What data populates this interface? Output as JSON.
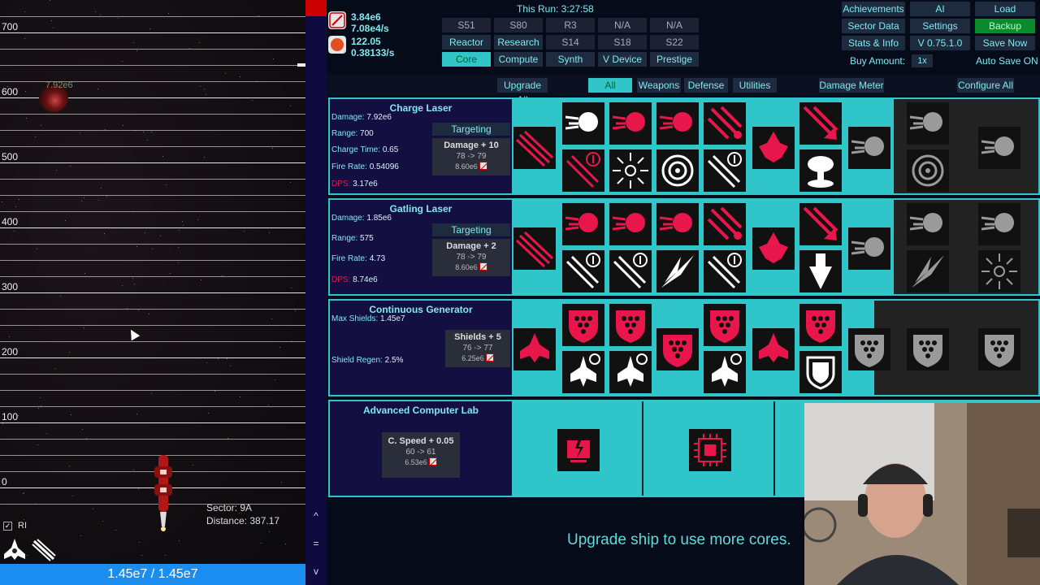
{
  "game": {
    "y_axis_labels": [
      "700",
      "600",
      "500",
      "400",
      "300",
      "200",
      "100",
      "0"
    ],
    "enemy_hp": "7.92e6",
    "sector": "Sector: 9A",
    "distance": "Distance: 387.17",
    "ri_label": "RI",
    "ri_check": "✓",
    "hp": "1.45e7 / 1.45e7",
    "scroll_up": "^",
    "scroll_mid": "=",
    "scroll_down": "v"
  },
  "resources": [
    {
      "primary": "3.84e6",
      "secondary": "7.08e4/s",
      "icon": "laser-resource-icon",
      "color": "#e6e6e6"
    },
    {
      "primary": "122.05",
      "secondary": "0.38133/s",
      "icon": "orange-orb-icon",
      "color": "#e05020"
    }
  ],
  "this_run": "This Run: 3:27:58",
  "core_tabs": [
    {
      "label": "S51",
      "kind": "label"
    },
    {
      "label": "S80",
      "kind": "label"
    },
    {
      "label": "R3",
      "kind": "label"
    },
    {
      "label": "N/A",
      "kind": "label"
    },
    {
      "label": "N/A",
      "kind": "label"
    },
    {
      "label": "Reactor",
      "kind": "btn"
    },
    {
      "label": "Research",
      "kind": "btn"
    },
    {
      "label": "S14",
      "kind": "label"
    },
    {
      "label": "S18",
      "kind": "label"
    },
    {
      "label": "S22",
      "kind": "label"
    },
    {
      "label": "Core",
      "kind": "active"
    },
    {
      "label": "Compute",
      "kind": "btn"
    },
    {
      "label": "Synth",
      "kind": "btn"
    },
    {
      "label": "V Device",
      "kind": "btn"
    },
    {
      "label": "Prestige",
      "kind": "btn"
    }
  ],
  "menu": {
    "achievements": "Achievements",
    "ai": "AI",
    "load": "Load",
    "sector_data": "Sector Data",
    "settings": "Settings",
    "backup": "Backup",
    "stats": "Stats & Info",
    "version": "V 0.75.1.0",
    "save_now": "Save Now",
    "buy_amount_label": "Buy Amount:",
    "buy_amount": "1x",
    "autosave": "Auto Save ON"
  },
  "toolbar": {
    "upgrade_all": "Upgrade All",
    "all": "All",
    "weapons": "Weapons",
    "defense": "Defense",
    "utilities": "Utilities",
    "damage_meter": "Damage Meter",
    "configure_all": "Configure All"
  },
  "modules": [
    {
      "title": "Charge Laser",
      "stats": [
        {
          "k": "Damage: ",
          "v": "7.92e6"
        },
        {
          "k": "Range: ",
          "v": "700"
        },
        {
          "k": "Charge Time: ",
          "v": "0.65"
        },
        {
          "k": "Fire Rate: ",
          "v": "0.54096"
        },
        {
          "k": "DPS: ",
          "v": "3.17e6"
        }
      ],
      "targeting": "Targeting",
      "upgrade": {
        "title": "Damage + 10",
        "levels": "78 -> 79",
        "cost": "8.60e6"
      }
    },
    {
      "title": "Gatling Laser",
      "stats": [
        {
          "k": "Damage: ",
          "v": "1.85e6"
        },
        {
          "k": "Range: ",
          "v": "575"
        },
        {
          "k": "Fire Rate: ",
          "v": "4.73"
        },
        {
          "k": "DPS: ",
          "v": "8.74e6"
        }
      ],
      "targeting": "Targeting",
      "upgrade": {
        "title": "Damage + 2",
        "levels": "78 -> 79",
        "cost": "8.60e6"
      }
    },
    {
      "title": "Continuous Generator",
      "stats": [
        {
          "k": "Max Shields: ",
          "v": "1.45e7"
        },
        {
          "k": "Shield Regen: ",
          "v": "2.5%"
        }
      ],
      "upgrade": {
        "title": "Shields + 5",
        "levels": "76 -> 77",
        "cost": "6.25e6"
      }
    },
    {
      "title": "Advanced Computer Lab",
      "stats": [],
      "upgrade": {
        "title": "C. Speed + 0.05",
        "levels": "60 -> 61",
        "cost": "6.53e6"
      }
    }
  ],
  "core_note": "Upgrade ship to use more cores."
}
